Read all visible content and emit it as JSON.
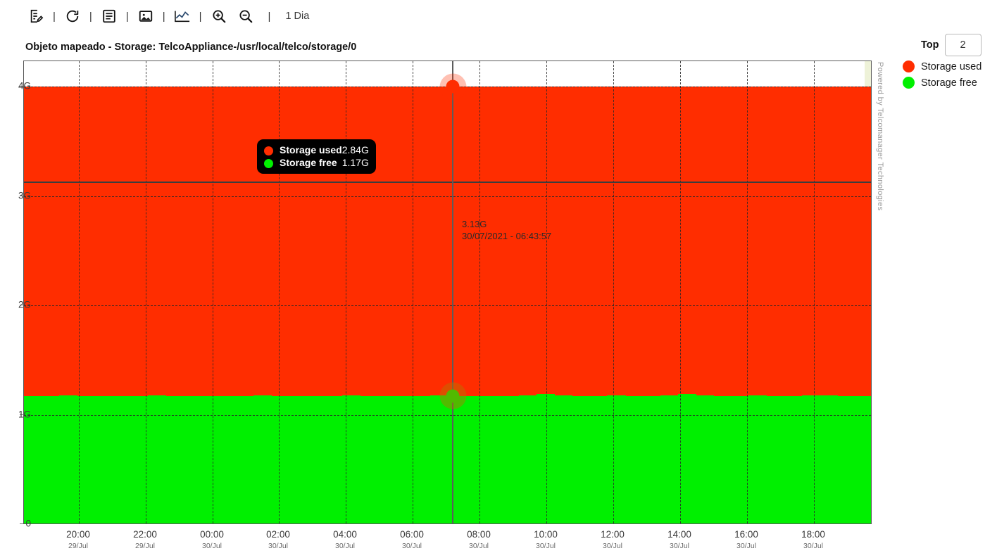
{
  "toolbar": {
    "buttons": [
      {
        "name": "report-edit-icon",
        "title": "Relatorio"
      },
      {
        "name": "refresh-icon",
        "title": "Atualizar"
      },
      {
        "name": "list-icon",
        "title": "Lista"
      },
      {
        "name": "image-icon",
        "title": "Imagem"
      },
      {
        "name": "line-chart-icon",
        "title": "Grafico"
      },
      {
        "name": "zoom-in-icon",
        "title": "Zoom in"
      },
      {
        "name": "zoom-out-icon",
        "title": "Zoom out"
      }
    ],
    "separator": "|",
    "period_label": "1 Dia"
  },
  "chart_title": "Objeto mapeado - Storage:  TelcoAppliance-/usr/local/telco/storage/0",
  "watermark": "Powered by Telcomanager Technologies",
  "legend_panel": {
    "top_label": "Top",
    "top_value": "2",
    "items": [
      {
        "label": "Storage used",
        "color": "#ff2d00"
      },
      {
        "label": "Storage free",
        "color": "#00f000"
      }
    ]
  },
  "tooltip": {
    "rows": [
      {
        "name": "Storage used",
        "value": "2.84G",
        "color": "#ff2d00"
      },
      {
        "name": "Storage free",
        "value": "1.17G",
        "color": "#00f000"
      }
    ]
  },
  "crosshair": {
    "value_label": "3.13G",
    "time_label": "30/07/2021 - 06:43:57"
  },
  "chart_data": {
    "type": "area",
    "stacked": true,
    "title": "Objeto mapeado - Storage:  TelcoAppliance-/usr/local/telco/storage/0",
    "xlabel": "",
    "ylabel": "",
    "ylim": [
      0,
      4294967296
    ],
    "ylim_label": [
      "0",
      "4G"
    ],
    "grid": true,
    "legend_position": "right",
    "y_ticks": [
      {
        "label": "0",
        "value": 0
      },
      {
        "label": "1G",
        "value": 1073741824
      },
      {
        "label": "2G",
        "value": 2147483648
      },
      {
        "label": "3G",
        "value": 3221225472
      },
      {
        "label": "4G",
        "value": 4294967296
      }
    ],
    "x_ticks": [
      {
        "time": "20:00",
        "date": "29/Jul"
      },
      {
        "time": "22:00",
        "date": "29/Jul"
      },
      {
        "time": "00:00",
        "date": "30/Jul"
      },
      {
        "time": "02:00",
        "date": "30/Jul"
      },
      {
        "time": "04:00",
        "date": "30/Jul"
      },
      {
        "time": "06:00",
        "date": "30/Jul"
      },
      {
        "time": "08:00",
        "date": "30/Jul"
      },
      {
        "time": "10:00",
        "date": "30/Jul"
      },
      {
        "time": "12:00",
        "date": "30/Jul"
      },
      {
        "time": "14:00",
        "date": "30/Jul"
      },
      {
        "time": "16:00",
        "date": "30/Jul"
      },
      {
        "time": "18:00",
        "date": "30/Jul"
      }
    ],
    "threshold": {
      "label": "3.13G",
      "value": 3.13
    },
    "series": [
      {
        "name": "Storage free",
        "color": "#00f000",
        "unit": "G",
        "selected_value": 1.17,
        "values": [
          1.17,
          1.17,
          1.18,
          1.17,
          1.17,
          1.16,
          1.17,
          1.18,
          1.17,
          1.17,
          1.16,
          1.17,
          1.17,
          1.18,
          1.17,
          1.16,
          1.17,
          1.17,
          1.18,
          1.17,
          1.17,
          1.16,
          1.17,
          1.18,
          1.17,
          1.17,
          1.16,
          1.15,
          1.18,
          1.19,
          1.18,
          1.17,
          1.17,
          1.18,
          1.17,
          1.17,
          1.18,
          1.19,
          1.18,
          1.17,
          1.17,
          1.18,
          1.17,
          1.17,
          1.18,
          1.18,
          1.17,
          1.17
        ]
      },
      {
        "name": "Storage used",
        "color": "#ff2d00",
        "unit": "G",
        "selected_value": 2.84,
        "values": [
          2.84,
          2.84,
          2.83,
          2.84,
          2.84,
          2.85,
          2.84,
          2.83,
          2.84,
          2.84,
          2.85,
          2.84,
          2.84,
          2.83,
          2.84,
          2.85,
          2.84,
          2.84,
          2.83,
          2.84,
          2.84,
          2.85,
          2.84,
          2.83,
          2.84,
          2.84,
          2.85,
          2.86,
          2.83,
          2.82,
          2.83,
          2.84,
          2.84,
          2.83,
          2.84,
          2.84,
          2.83,
          2.82,
          2.83,
          2.84,
          2.84,
          2.83,
          2.84,
          2.84,
          2.83,
          2.83,
          2.84,
          2.84
        ]
      }
    ],
    "total_value": 4.0,
    "selected_point": {
      "time": "30/07/2021 - 06:43:57",
      "total": "3.13G"
    }
  }
}
